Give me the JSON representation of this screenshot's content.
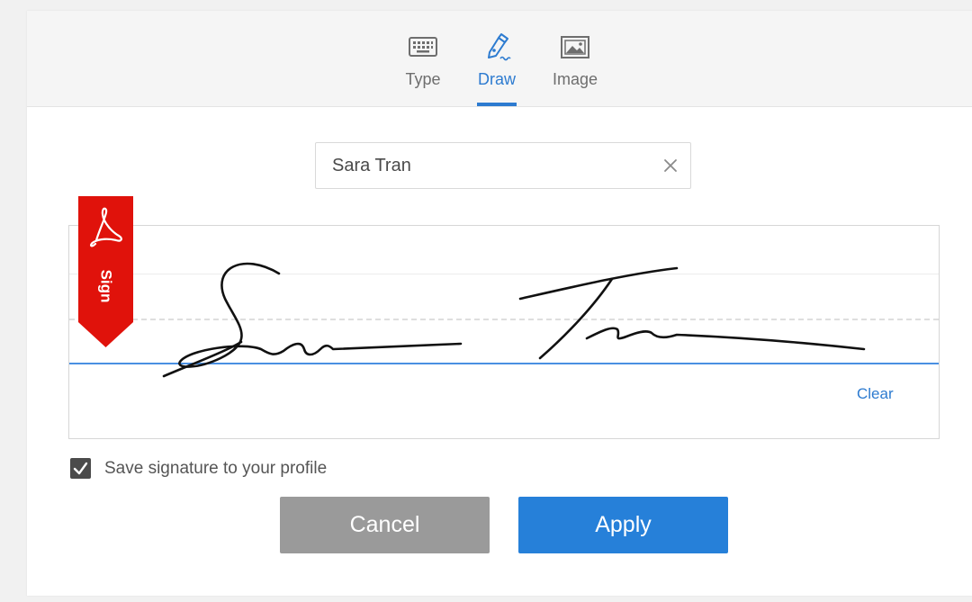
{
  "tabs": {
    "type_label": "Type",
    "draw_label": "Draw",
    "image_label": "Image",
    "active": "draw"
  },
  "name_field": {
    "value": "Sara Tran"
  },
  "sign_flag": {
    "label": "Sign"
  },
  "signature_canvas": {
    "clear_label": "Clear"
  },
  "save_option": {
    "label": "Save signature to your profile",
    "checked": true
  },
  "buttons": {
    "cancel_label": "Cancel",
    "apply_label": "Apply"
  },
  "colors": {
    "accent": "#2680d9",
    "flag_red": "#e0120b",
    "cancel_gray": "#9a9a9a"
  },
  "icons": {
    "type_tab": "keyboard-icon",
    "draw_tab": "pen-icon",
    "image_tab": "image-icon",
    "clear_field": "close-icon",
    "flag": "acrobat-logo-icon",
    "checkbox": "checkmark-icon"
  }
}
